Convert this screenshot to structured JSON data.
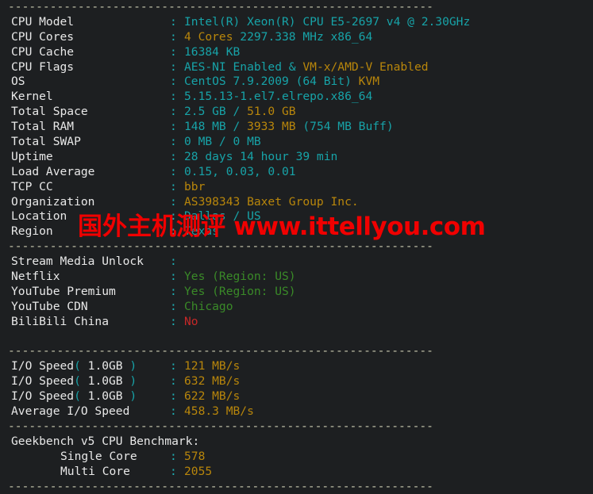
{
  "terminal": {
    "background_color": "#1d1f21",
    "label_color": "#e8e8e8",
    "accent_cyan": "#17a3a8",
    "accent_orange": "#b8860b",
    "accent_green": "#3a8a28",
    "accent_red": "#c62828",
    "separator": "-------------------------------------------------------------",
    "colon": ":"
  },
  "watermark": {
    "chinese": "国外主机测评",
    "url": "www.ittellyou.com",
    "color": "#f00000"
  },
  "system_info": {
    "rows": [
      {
        "label": "CPU Model",
        "value": "Intel(R) Xeon(R) CPU E5-2697 v4 @ 2.30GHz"
      },
      {
        "label": "CPU Cores",
        "value": "4 Cores 2297.338 MHz x86_64"
      },
      {
        "label": "CPU Cache",
        "value": "16384 KB"
      },
      {
        "label": "CPU Flags",
        "value": "AES-NI Enabled & VM-x/AMD-V Enabled"
      },
      {
        "label": "OS",
        "value": "CentOS 7.9.2009 (64 Bit) KVM"
      },
      {
        "label": "Kernel",
        "value": "5.15.13-1.el7.elrepo.x86_64"
      },
      {
        "label": "Total Space",
        "value": "2.5 GB / 51.0 GB"
      },
      {
        "label": "Total RAM",
        "value": "148 MB / 3933 MB (754 MB Buff)"
      },
      {
        "label": "Total SWAP",
        "value": "0 MB / 0 MB"
      },
      {
        "label": "Uptime",
        "value": "28 days 14 hour 39 min"
      },
      {
        "label": "Load Average",
        "value": "0.15, 0.03, 0.01"
      },
      {
        "label": "TCP CC",
        "value": "bbr"
      },
      {
        "label": "Organization",
        "value": "AS398343 Baxet Group Inc."
      },
      {
        "label": "Location",
        "value": "Dallas / US"
      },
      {
        "label": "Region",
        "value": "Texas"
      }
    ],
    "cpu_model": {
      "full": "Intel(R) Xeon(R) CPU E5-2697 v4 @ 2.30GHz",
      "label": "CPU Model"
    },
    "cpu_cores": {
      "label": "CPU Cores",
      "cores": "4 Cores",
      "rest": " 2297.338 MHz x86_64"
    },
    "cpu_cache": {
      "label": "CPU Cache",
      "value": "16384 KB"
    },
    "cpu_flags": {
      "label": "CPU Flags",
      "aes": "AES-NI Enabled & ",
      "vmx": "VM-x/AMD-V Enabled"
    },
    "os": {
      "label": "OS",
      "name": "CentOS 7.9.2009 (64 Bit) ",
      "virt": "KVM"
    },
    "kernel": {
      "label": "Kernel",
      "value": "5.15.13-1.el7.elrepo.x86_64"
    },
    "total_space": {
      "label": "Total Space",
      "used": "2.5 GB / ",
      "total": "51.0 GB"
    },
    "total_ram": {
      "label": "Total RAM",
      "used": "148 MB / ",
      "total": "3933 MB",
      "buff": " (754 MB Buff)"
    },
    "total_swap": {
      "label": "Total SWAP",
      "value": "0 MB / 0 MB"
    },
    "uptime": {
      "label": "Uptime",
      "value": "28 days 14 hour 39 min"
    },
    "load_average": {
      "label": "Load Average",
      "value": "0.15, 0.03, 0.01"
    },
    "tcp_cc": {
      "label": "TCP CC",
      "value": "bbr"
    },
    "organization": {
      "label": "Organization",
      "value": "AS398343 Baxet Group Inc."
    },
    "location": {
      "label": "Location",
      "value": "Dallas / US"
    },
    "region": {
      "label": "Region",
      "value": "Texas"
    }
  },
  "stream_unlock": {
    "header_label": "Stream Media Unlock",
    "rows": [
      {
        "label": "Netflix",
        "value": "Yes (Region: US)",
        "color": "green"
      },
      {
        "label": "YouTube Premium",
        "value": "Yes (Region: US)",
        "color": "green"
      },
      {
        "label": "YouTube CDN",
        "value": "Chicago",
        "color": "green"
      },
      {
        "label": "BiliBili China",
        "value": "No",
        "color": "red"
      }
    ],
    "netflix": {
      "label": "Netflix",
      "value": "Yes (Region: US)"
    },
    "youtube_premium": {
      "label": "YouTube Premium",
      "value": "Yes (Region: US)"
    },
    "youtube_cdn": {
      "label": "YouTube CDN",
      "value": "Chicago"
    },
    "bilibili": {
      "label": "BiliBili China",
      "value": "No"
    }
  },
  "io_speed": {
    "rows": [
      {
        "label": "I/O Speed( 1.0GB )",
        "value": "121 MB/s"
      },
      {
        "label": "I/O Speed( 1.0GB )",
        "value": "632 MB/s"
      },
      {
        "label": "I/O Speed( 1.0GB )",
        "value": "622 MB/s"
      },
      {
        "label": "Average I/O Speed",
        "value": "458.3 MB/s"
      }
    ],
    "label_prefix": "I/O Speed",
    "paren_open": "( ",
    "size": "1.0GB",
    "paren_close": " )",
    "test1": "121 MB/s",
    "test2": "632 MB/s",
    "test3": "622 MB/s",
    "average_label": "Average I/O Speed",
    "average": "458.3 MB/s"
  },
  "geekbench": {
    "title": "Geekbench v5 CPU Benchmark:",
    "single_core_label": "Single Core",
    "single_core": "578",
    "multi_core_label": "Multi Core",
    "multi_core": "2055"
  }
}
